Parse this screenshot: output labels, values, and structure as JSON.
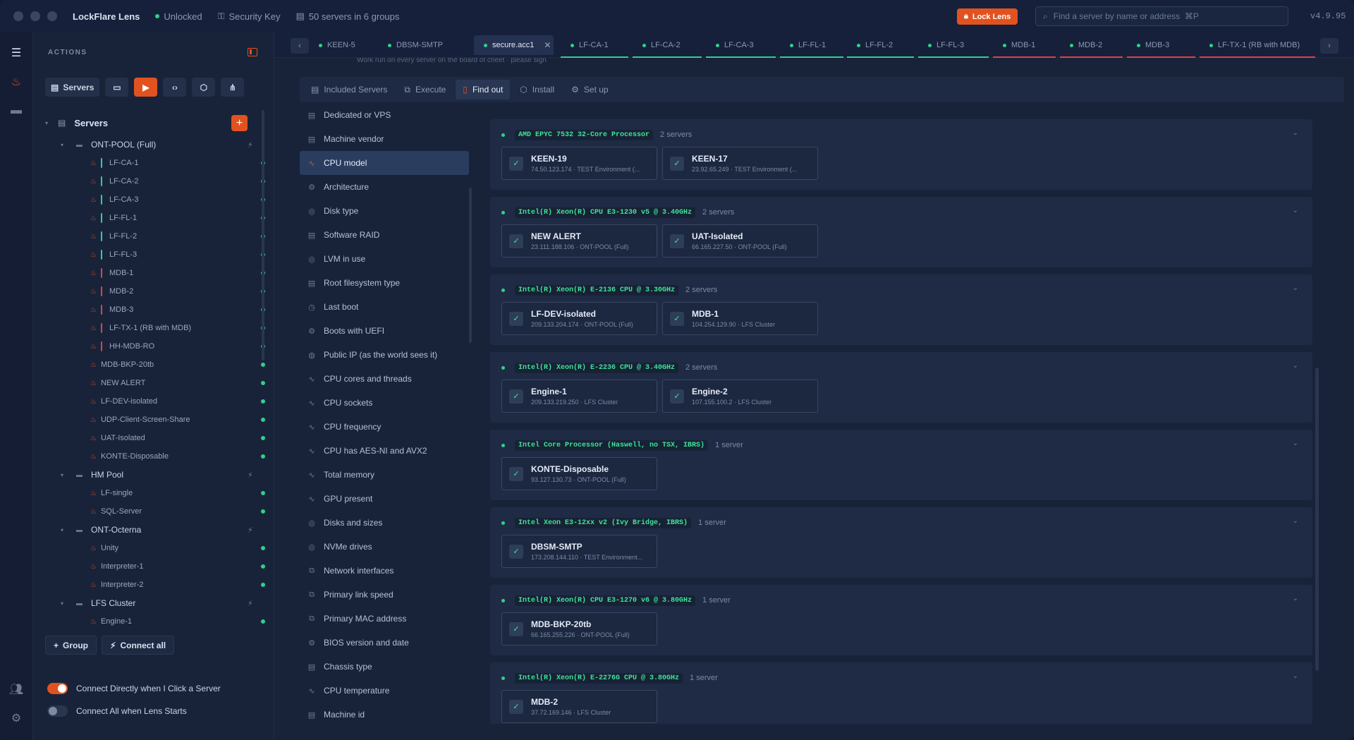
{
  "titlebar": {
    "app_name": "LockFlare Lens",
    "status": "Unlocked",
    "key": "Security Key",
    "servers": "50 servers in 6 groups",
    "lock_label": "Lock Lens",
    "search_placeholder": "Find a server by name or address  ⌘P",
    "version": "v4.9.95"
  },
  "sidebar": {
    "actions_title": "ACTIONS",
    "servers_button": "Servers",
    "tree_title": "Servers",
    "tree": [
      {
        "type": "group",
        "label": "ONT-POOL (Full)"
      },
      {
        "type": "server",
        "label": "LF-CA-1",
        "bar": "g"
      },
      {
        "type": "server",
        "label": "LF-CA-2",
        "bar": "g"
      },
      {
        "type": "server",
        "label": "LF-CA-3",
        "bar": "g"
      },
      {
        "type": "server",
        "label": "LF-FL-1",
        "bar": "g"
      },
      {
        "type": "server",
        "label": "LF-FL-2",
        "bar": "g"
      },
      {
        "type": "server",
        "label": "LF-FL-3",
        "bar": "g"
      },
      {
        "type": "server",
        "label": "MDB-1",
        "bar": "r"
      },
      {
        "type": "server",
        "label": "MDB-2",
        "bar": "r"
      },
      {
        "type": "server",
        "label": "MDB-3",
        "bar": "r"
      },
      {
        "type": "server",
        "label": "LF-TX-1 (RB with MDB)",
        "bar": "r"
      },
      {
        "type": "server",
        "label": "HH-MDB-RO",
        "bar": "r"
      },
      {
        "type": "server",
        "label": "MDB-BKP-20tb",
        "bar": ""
      },
      {
        "type": "server",
        "label": "NEW ALERT",
        "bar": ""
      },
      {
        "type": "server",
        "label": "LF-DEV-isolated",
        "bar": ""
      },
      {
        "type": "server",
        "label": "UDP-Client-Screen-Share",
        "bar": ""
      },
      {
        "type": "server",
        "label": "UAT-Isolated",
        "bar": ""
      },
      {
        "type": "server",
        "label": "KONTE-Disposable",
        "bar": ""
      },
      {
        "type": "group",
        "label": "HM Pool"
      },
      {
        "type": "server",
        "label": "LF-single",
        "bar": ""
      },
      {
        "type": "server",
        "label": "SQL-Server",
        "bar": ""
      },
      {
        "type": "group",
        "label": "ONT-Octerna"
      },
      {
        "type": "server",
        "label": "Unity",
        "bar": ""
      },
      {
        "type": "server",
        "label": "Interpreter-1",
        "bar": ""
      },
      {
        "type": "server",
        "label": "Interpreter-2",
        "bar": ""
      },
      {
        "type": "group",
        "label": "LFS Cluster"
      },
      {
        "type": "server",
        "label": "Engine-1",
        "bar": ""
      }
    ],
    "group_button": "Group",
    "connect_all_button": "Connect all",
    "toggle_direct": "Connect Directly when I Click a Server",
    "toggle_all": "Connect All when Lens Starts"
  },
  "tabs": [
    {
      "label": "KEEN-5",
      "line": ""
    },
    {
      "label": "DBSM-SMTP",
      "line": ""
    },
    {
      "label": "secure.acc1",
      "line": "",
      "active": true
    },
    {
      "label": "LF-CA-1",
      "line": "g"
    },
    {
      "label": "LF-CA-2",
      "line": "g"
    },
    {
      "label": "LF-CA-3",
      "line": "g"
    },
    {
      "label": "LF-FL-1",
      "line": "g"
    },
    {
      "label": "LF-FL-2",
      "line": "g"
    },
    {
      "label": "LF-FL-3",
      "line": "g"
    },
    {
      "label": "MDB-1",
      "line": "r"
    },
    {
      "label": "MDB-2",
      "line": "r"
    },
    {
      "label": "MDB-3",
      "line": "r"
    },
    {
      "label": "LF-TX-1 (RB with MDB)",
      "line": "r"
    }
  ],
  "cropped_text": "Work run on every server on the board of cheet · please sign",
  "subtabs": [
    "Included Servers",
    "Execute",
    "Find out",
    "Install",
    "Set up"
  ],
  "categories": [
    {
      "label": "Dedicated or VPS",
      "icon": "▤"
    },
    {
      "label": "Machine vendor",
      "icon": "▤"
    },
    {
      "label": "CPU model",
      "icon": "∿",
      "active": true
    },
    {
      "label": "Architecture",
      "icon": "⚙"
    },
    {
      "label": "Disk type",
      "icon": "◎"
    },
    {
      "label": "Software RAID",
      "icon": "▤"
    },
    {
      "label": "LVM in use",
      "icon": "◎"
    },
    {
      "label": "Root filesystem type",
      "icon": "▤"
    },
    {
      "label": "Last boot",
      "icon": "◷"
    },
    {
      "label": "Boots with UEFI",
      "icon": "⚙"
    },
    {
      "label": "Public IP (as the world sees it)",
      "icon": "◍"
    },
    {
      "label": "CPU cores and threads",
      "icon": "∿"
    },
    {
      "label": "CPU sockets",
      "icon": "∿"
    },
    {
      "label": "CPU frequency",
      "icon": "∿"
    },
    {
      "label": "CPU has AES-NI and AVX2",
      "icon": "∿"
    },
    {
      "label": "Total memory",
      "icon": "∿"
    },
    {
      "label": "GPU present",
      "icon": "∿"
    },
    {
      "label": "Disks and sizes",
      "icon": "◎"
    },
    {
      "label": "NVMe drives",
      "icon": "◎"
    },
    {
      "label": "Network interfaces",
      "icon": "⧉"
    },
    {
      "label": "Primary link speed",
      "icon": "⧉"
    },
    {
      "label": "Primary MAC address",
      "icon": "⧉"
    },
    {
      "label": "BIOS version and date",
      "icon": "⚙"
    },
    {
      "label": "Chassis type",
      "icon": "▤"
    },
    {
      "label": "CPU temperature",
      "icon": "∿"
    },
    {
      "label": "Machine id",
      "icon": "▤"
    }
  ],
  "groups": [
    {
      "cpu": "AMD EPYC 7532 32-Core Processor",
      "count": "2 servers",
      "servers": [
        {
          "name": "KEEN-19",
          "sub": "74.50.123.174 · TEST Environment (..."
        },
        {
          "name": "KEEN-17",
          "sub": "23.92.65.249 · TEST Environment (..."
        }
      ]
    },
    {
      "cpu": "Intel(R) Xeon(R) CPU E3-1230 v5 @ 3.40GHz",
      "count": "2 servers",
      "servers": [
        {
          "name": "NEW ALERT",
          "sub": "23.111.188.106 · ONT-POOL (Full)"
        },
        {
          "name": "UAT-Isolated",
          "sub": "66.165.227.50 · ONT-POOL (Full)"
        }
      ]
    },
    {
      "cpu": "Intel(R) Xeon(R) E-2136 CPU @ 3.30GHz",
      "count": "2 servers",
      "servers": [
        {
          "name": "LF-DEV-isolated",
          "sub": "209.133.204.174 · ONT-POOL (Full)"
        },
        {
          "name": "MDB-1",
          "sub": "104.254.129.90 · LFS Cluster"
        }
      ]
    },
    {
      "cpu": "Intel(R) Xeon(R) E-2236 CPU @ 3.40GHz",
      "count": "2 servers",
      "servers": [
        {
          "name": "Engine-1",
          "sub": "209.133.219.250 · LFS Cluster"
        },
        {
          "name": "Engine-2",
          "sub": "107.155.100.2 · LFS Cluster"
        }
      ]
    },
    {
      "cpu": "Intel Core Processor (Haswell, no TSX, IBRS)",
      "count": "1 server",
      "servers": [
        {
          "name": "KONTE-Disposable",
          "sub": "93.127.130.73 · ONT-POOL (Full)"
        }
      ]
    },
    {
      "cpu": "Intel Xeon E3-12xx v2 (Ivy Bridge, IBRS)",
      "count": "1 server",
      "servers": [
        {
          "name": "DBSM-SMTP",
          "sub": "173.208.144.110 · TEST Environment..."
        }
      ]
    },
    {
      "cpu": "Intel(R) Xeon(R) CPU E3-1270 v6 @ 3.80GHz",
      "count": "1 server",
      "servers": [
        {
          "name": "MDB-BKP-20tb",
          "sub": "66.165.255.226 · ONT-POOL (Full)"
        }
      ]
    },
    {
      "cpu": "Intel(R) Xeon(R) E-2276G CPU @ 3.80GHz",
      "count": "1 server",
      "servers": [
        {
          "name": "MDB-2",
          "sub": "37.72.169.146 · LFS Cluster"
        }
      ]
    }
  ]
}
